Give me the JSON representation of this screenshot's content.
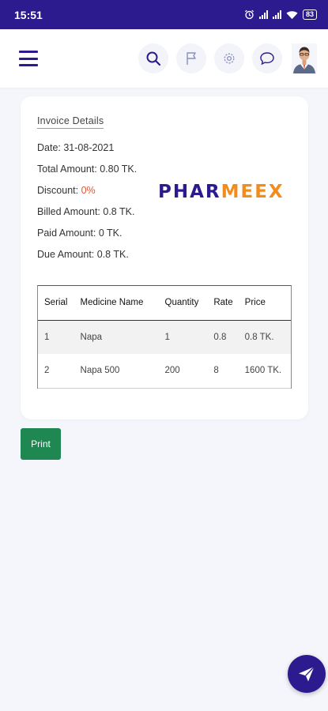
{
  "status_bar": {
    "time": "15:51",
    "battery": "83"
  },
  "header": {
    "icons": [
      "menu-icon",
      "search-icon",
      "flag-icon",
      "gear-icon",
      "chat-icon",
      "avatar"
    ]
  },
  "invoice": {
    "title": "Invoice Details",
    "date": "Date: 31-08-2021",
    "total_amount": "Total Amount: 0.80 TK.",
    "discount_label": "Discount:",
    "discount_value": "0%",
    "billed_amount": "Billed Amount: 0.8 TK.",
    "paid_amount": "Paid Amount: 0 TK.",
    "due_amount": "Due Amount: 0.8 TK."
  },
  "logo": {
    "part1": "PHAR",
    "part2": "MEEX",
    "colors": {
      "part1": "#2c1b8f",
      "part2": "#f28c1c"
    }
  },
  "table": {
    "headers": [
      "Serial",
      "Medicine Name",
      "Quantity",
      "Rate",
      "Price"
    ],
    "rows": [
      [
        "1",
        "Napa",
        "1",
        "0.8",
        "0.8 TK."
      ],
      [
        "2",
        "Napa 500",
        "200",
        "8",
        "1600 TK."
      ]
    ]
  },
  "actions": {
    "print_label": "Print"
  },
  "colors": {
    "brand": "#2c1b8f",
    "print_button": "#1f8752",
    "discount": "#e05536"
  }
}
